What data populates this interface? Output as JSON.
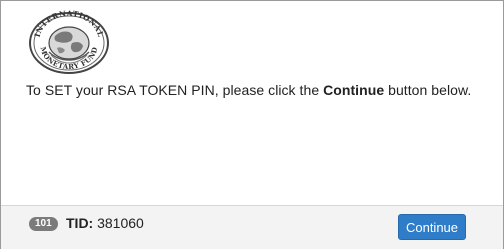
{
  "logo": {
    "top_text": "INTERNATIONAL",
    "bottom_text": "MONETARY FUND"
  },
  "message": {
    "prefix": "To SET your RSA TOKEN PIN, please click the ",
    "bold": "Continue",
    "suffix": " button below."
  },
  "footer": {
    "badge": "101",
    "tid_label": "TID:",
    "tid_value": "381060",
    "continue_label": "Continue"
  },
  "colors": {
    "button": "#2f7cc8",
    "badge": "#7b7b7b",
    "footer_bg": "#f3f3f3"
  }
}
